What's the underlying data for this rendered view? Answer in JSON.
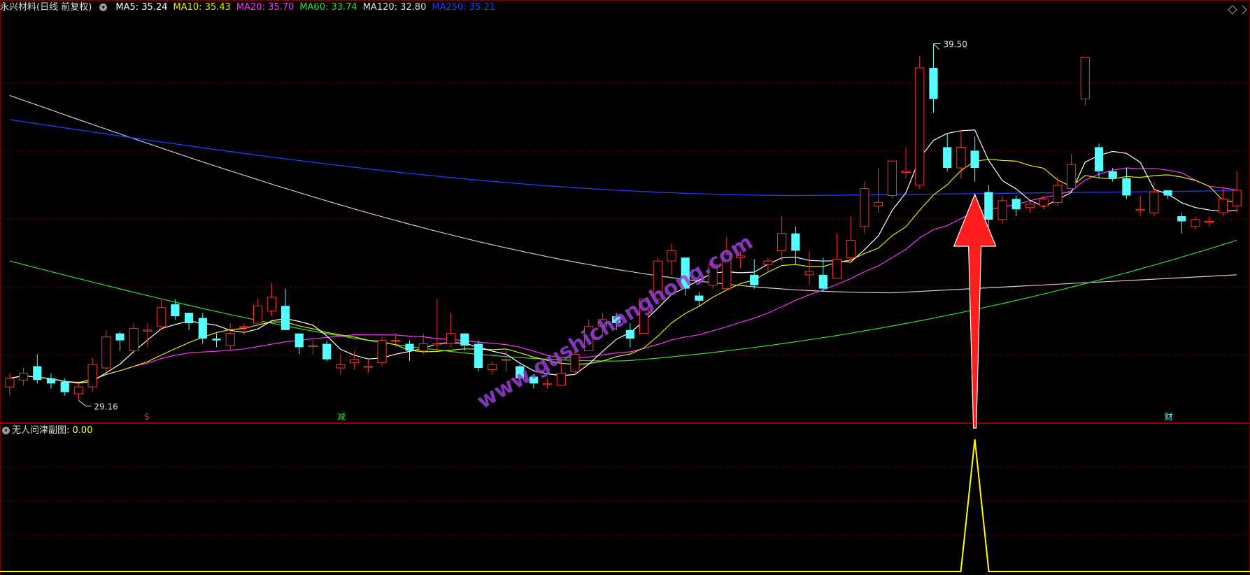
{
  "header": {
    "stock_title": "永兴材料(日线 前复权)",
    "ma_labels": [
      {
        "key": "ma5",
        "text": "MA5: 35.24",
        "color": "#ffffff"
      },
      {
        "key": "ma10",
        "text": "MA10: 35.43",
        "color": "#e8e800"
      },
      {
        "key": "ma20",
        "text": "MA20: 35.70",
        "color": "#ff33ff"
      },
      {
        "key": "ma60",
        "text": "MA60: 33.74",
        "color": "#33dd33"
      },
      {
        "key": "ma120",
        "text": "MA120: 32.80",
        "color": "#dddddd"
      },
      {
        "key": "ma250",
        "text": "MA250: 35.21",
        "color": "#2a3aff"
      }
    ]
  },
  "sub_header": {
    "title": "无人问津副图",
    "value": ": 0.00"
  },
  "colors": {
    "up": "#ff3232",
    "down": "#54ffff",
    "grid": "#7a0000",
    "ma5": "#ffffff",
    "ma10": "#e8e800",
    "ma20": "#ff33ff",
    "ma60": "#33dd33",
    "ma120": "#cccccc",
    "ma250": "#2a3aff",
    "indicator": "#ffff00",
    "arrow": "#ff1e1e",
    "watermark": "#9b3ed8"
  },
  "markers": [
    {
      "text": "S",
      "color": "#ff3232",
      "x_index": 10
    },
    {
      "text": "减",
      "color": "#33dd33",
      "x_index": 24
    },
    {
      "text": "财",
      "color": "#54ffff",
      "x_index": 84
    }
  ],
  "annotations": {
    "high_label": "39.50",
    "low_label": "29.16"
  },
  "watermark": "www.gushichanghong.com",
  "chart_data": {
    "type": "candlestick",
    "title": "永兴材料(日线 前复权)",
    "high": 39.5,
    "low": 29.16,
    "price_range": [
      28.6,
      40.2
    ],
    "candles": [
      [
        29.55,
        29.8,
        29.3,
        29.95
      ],
      [
        29.75,
        29.95,
        29.6,
        30.1
      ],
      [
        30.15,
        29.75,
        29.65,
        30.5
      ],
      [
        29.8,
        29.65,
        29.5,
        29.95
      ],
      [
        29.7,
        29.4,
        29.3,
        29.8
      ],
      [
        29.35,
        29.55,
        29.16,
        29.65
      ],
      [
        29.55,
        30.2,
        29.4,
        30.4
      ],
      [
        30.1,
        31.0,
        30.0,
        31.2
      ],
      [
        31.1,
        30.9,
        30.6,
        31.15
      ],
      [
        30.6,
        31.25,
        30.5,
        31.4
      ],
      [
        31.2,
        31.2,
        30.7,
        31.4
      ],
      [
        31.3,
        31.85,
        31.2,
        32.1
      ],
      [
        31.95,
        31.6,
        31.5,
        32.1
      ],
      [
        31.7,
        31.4,
        31.2,
        31.7
      ],
      [
        31.55,
        30.95,
        30.8,
        31.7
      ],
      [
        30.95,
        30.9,
        30.7,
        31.1
      ],
      [
        30.75,
        31.1,
        30.6,
        31.4
      ],
      [
        31.3,
        31.3,
        31.05,
        31.4
      ],
      [
        31.4,
        31.9,
        31.4,
        32.1
      ],
      [
        31.75,
        32.15,
        31.6,
        32.55
      ],
      [
        31.9,
        31.2,
        31.2,
        32.4
      ],
      [
        31.1,
        30.7,
        30.5,
        31.1
      ],
      [
        30.75,
        30.75,
        30.5,
        30.9
      ],
      [
        30.8,
        30.35,
        30.3,
        30.9
      ],
      [
        30.1,
        30.2,
        29.9,
        30.5
      ],
      [
        30.25,
        30.35,
        30.05,
        30.6
      ],
      [
        30.15,
        30.15,
        29.95,
        30.35
      ],
      [
        30.25,
        30.9,
        30.15,
        31.0
      ],
      [
        30.9,
        30.9,
        30.7,
        31.1
      ],
      [
        30.8,
        30.6,
        30.3,
        30.9
      ],
      [
        30.6,
        30.8,
        30.5,
        31.1
      ],
      [
        30.8,
        30.8,
        30.6,
        32.1
      ],
      [
        30.8,
        31.1,
        30.7,
        31.7
      ],
      [
        31.1,
        30.75,
        30.6,
        31.1
      ],
      [
        30.8,
        30.1,
        30.0,
        30.9
      ],
      [
        30.05,
        30.2,
        29.9,
        30.3
      ],
      [
        30.35,
        30.35,
        30.0,
        30.6
      ],
      [
        30.15,
        29.8,
        29.7,
        30.2
      ],
      [
        29.85,
        29.65,
        29.5,
        29.9
      ],
      [
        29.65,
        29.65,
        29.5,
        29.8
      ],
      [
        29.6,
        29.95,
        29.6,
        30.4
      ],
      [
        30.0,
        30.5,
        29.9,
        30.6
      ],
      [
        30.6,
        31.3,
        30.6,
        31.5
      ],
      [
        31.3,
        31.5,
        31.0,
        31.7
      ],
      [
        31.6,
        31.4,
        31.2,
        31.7
      ],
      [
        31.2,
        30.95,
        30.7,
        31.4
      ],
      [
        31.1,
        32.1,
        31.1,
        32.1
      ],
      [
        32.1,
        33.2,
        32.05,
        33.3
      ],
      [
        33.2,
        33.5,
        32.8,
        33.7
      ],
      [
        33.3,
        32.4,
        32.2,
        33.3
      ],
      [
        32.2,
        32.05,
        31.9,
        32.3
      ],
      [
        32.5,
        33.1,
        32.4,
        33.3
      ],
      [
        32.4,
        33.4,
        32.4,
        33.9
      ],
      [
        33.3,
        33.35,
        33.0,
        33.5
      ],
      [
        32.8,
        32.5,
        32.4,
        33.25
      ],
      [
        33.1,
        33.2,
        32.9,
        33.3
      ],
      [
        33.5,
        34.0,
        33.2,
        34.5
      ],
      [
        34.0,
        33.5,
        33.1,
        34.2
      ],
      [
        32.8,
        32.9,
        32.5,
        33.5
      ],
      [
        32.8,
        32.4,
        32.3,
        33.3
      ],
      [
        32.7,
        33.25,
        32.7,
        34.0
      ],
      [
        33.3,
        33.8,
        33.1,
        34.5
      ],
      [
        34.2,
        35.3,
        34.0,
        35.5
      ],
      [
        34.8,
        34.9,
        34.6,
        35.9
      ],
      [
        35.1,
        36.1,
        35.0,
        36.0
      ],
      [
        35.8,
        35.8,
        35.6,
        36.5
      ],
      [
        35.4,
        38.8,
        35.3,
        39.15
      ],
      [
        38.8,
        37.9,
        37.5,
        39.5
      ],
      [
        36.5,
        35.9,
        35.8,
        36.9
      ],
      [
        35.9,
        36.5,
        35.6,
        37.0
      ],
      [
        36.4,
        35.9,
        35.5,
        36.8
      ],
      [
        35.2,
        34.4,
        34.2,
        35.4
      ],
      [
        34.4,
        34.95,
        34.3,
        35.1
      ],
      [
        35.0,
        34.7,
        34.5,
        35.1
      ],
      [
        34.75,
        34.85,
        34.6,
        34.95
      ],
      [
        34.8,
        35.0,
        34.7,
        35.1
      ],
      [
        34.9,
        35.4,
        34.8,
        35.65
      ],
      [
        35.3,
        36.0,
        35.3,
        36.3
      ],
      [
        37.9,
        39.1,
        37.7,
        39.1
      ],
      [
        36.5,
        35.8,
        35.6,
        36.6
      ],
      [
        35.8,
        35.6,
        35.5,
        35.9
      ],
      [
        35.6,
        35.1,
        35.0,
        35.9
      ],
      [
        34.7,
        34.7,
        34.5,
        35.1
      ],
      [
        34.6,
        35.2,
        34.5,
        35.5
      ],
      [
        35.25,
        35.1,
        35.0,
        35.2
      ],
      [
        34.5,
        34.35,
        34.0,
        34.6
      ],
      [
        34.2,
        34.4,
        34.1,
        34.5
      ],
      [
        34.35,
        34.35,
        34.2,
        34.5
      ],
      [
        34.6,
        35.0,
        34.5,
        35.3
      ],
      [
        34.8,
        35.25,
        34.6,
        35.8
      ]
    ],
    "indicator": {
      "name": "无人问津副图",
      "spike_index": 70,
      "spike_value": 1,
      "current": 0.0
    }
  }
}
